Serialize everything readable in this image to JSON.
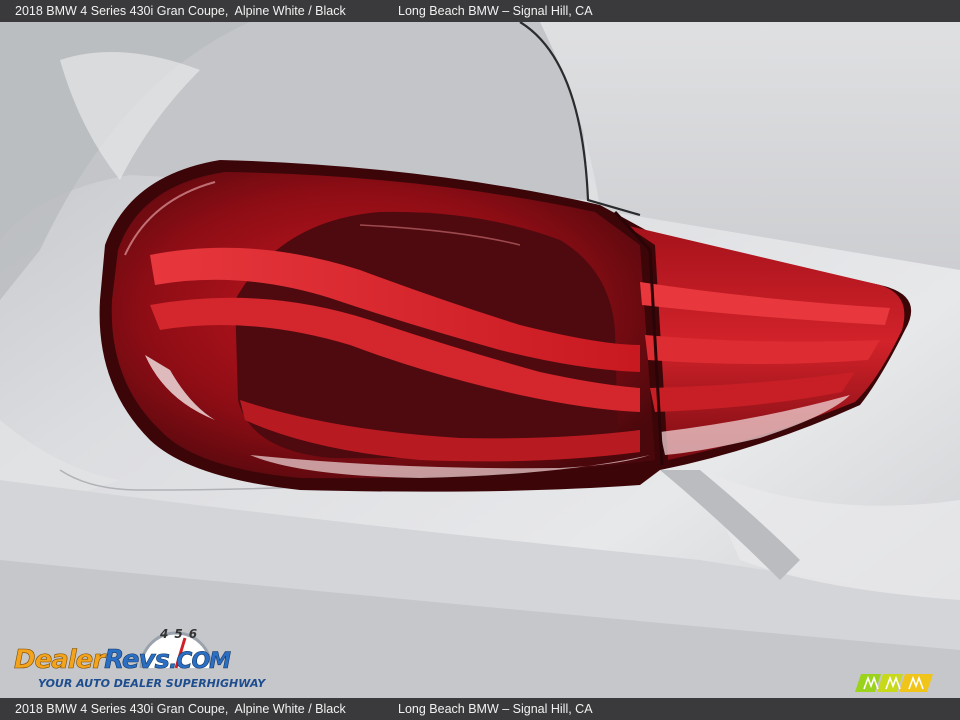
{
  "header": {
    "vehicle": "2018 BMW 4 Series 430i Gran Coupe,  Alpine White / Black",
    "dealer": "Long Beach BMW – Signal Hill, CA"
  },
  "footer": {
    "vehicle": "2018 BMW 4 Series 430i Gran Coupe,  Alpine White / Black",
    "dealer": "Long Beach BMW – Signal Hill, CA"
  },
  "watermark": {
    "brand_dealer": "Dealer",
    "brand_revs": "Revs",
    "brand_com": ".COM",
    "tagline": "YOUR AUTO DEALER SUPERHIGHWAY",
    "gauge_digits": "456"
  },
  "photo": {
    "subject": "tail-light-closeup",
    "colors": {
      "paint": "#d9dadc",
      "lens_dark": "#5a0d12",
      "lens_red": "#b3121c",
      "lens_bright": "#e23a3f"
    }
  },
  "icons": {
    "watermark_logo": "dealerrevs-logo",
    "corner_logo": "m-stripes-logo"
  }
}
